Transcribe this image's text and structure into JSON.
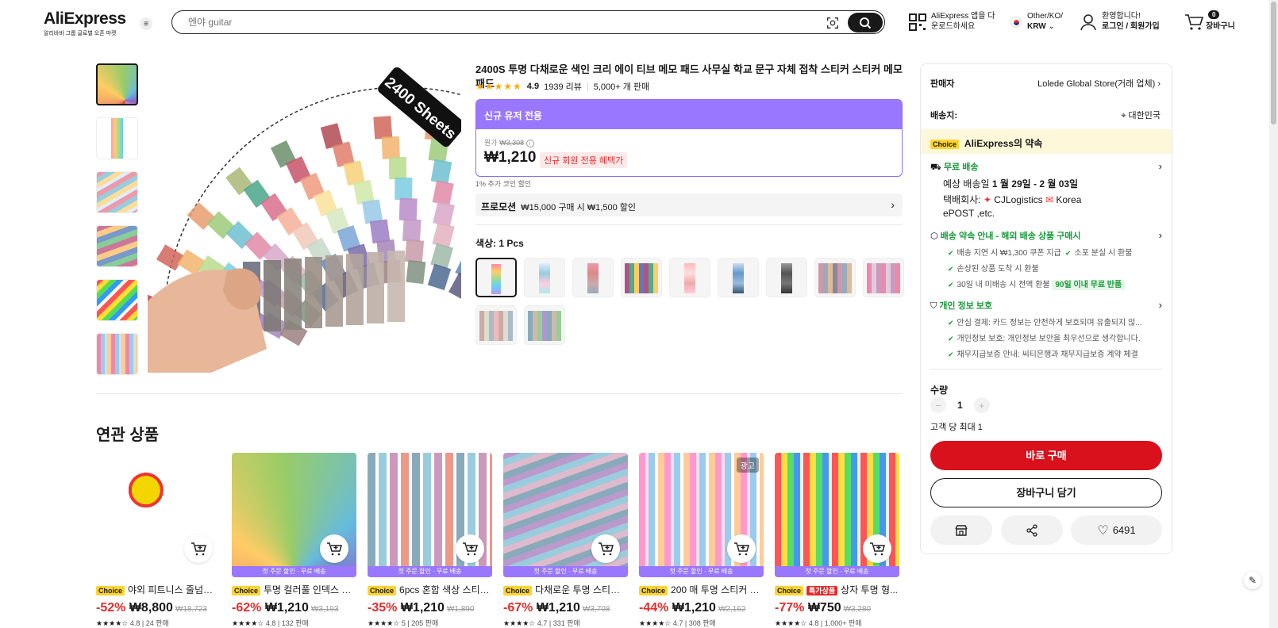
{
  "header": {
    "logo": "AliExpress",
    "logo_sub": "알리바바 그룹 글로벌 오픈 마켓",
    "search_placeholder": "엔야 guitar",
    "app_line1": "AliExpress 앱을 다",
    "app_line2": "운로드하세요",
    "region_line1": "Other/KO/",
    "region_line2": "KRW",
    "account_line1": "환영합니다!",
    "account_line2": "로그인 / 회원가입",
    "cart_count": "0",
    "cart_label": "장바구니"
  },
  "product": {
    "title": "2400S 투명 다채로운 색인 크리 에이 티브 메모 패드 사무실 학교 문구 자체 접착 스티커 스티커 메모 패드",
    "rating": "4.9",
    "reviews": "1939 리뷰",
    "sold": "5,000+ 개 판매",
    "image_banner": "2400 Sheets",
    "price_header": "신규 유저 전용",
    "orig_label": "원가",
    "orig_price": "₩3,308",
    "price": "₩1,210",
    "price_tag": "신규 회원 전용 혜택가",
    "coin_note": "1% 추가 코인 할인",
    "promo_title": "프로모션",
    "promo_text": "₩15,000 구매 시 ₩1,500 할인",
    "color_label": "색상: 1 Pcs"
  },
  "related": {
    "title": "연관 상품",
    "bar_text": "첫 주문 할인 · 무료 배송",
    "ad_label": "광고",
    "choice_label": "Choice",
    "items": [
      {
        "name": "야외 피트니스 줄넘기 ...",
        "disc": "-52%",
        "price": "₩8,800",
        "old": "₩18,723",
        "rating": "4.8",
        "sold": "24 판매",
        "badge": ""
      },
      {
        "name": "투명 컬러풀 인덱스 크...",
        "disc": "-62%",
        "price": "₩1,210",
        "old": "₩3,193",
        "rating": "4.8",
        "sold": "132 판매",
        "badge": ""
      },
      {
        "name": "6pcs 혼합 색상 스티커...",
        "disc": "-35%",
        "price": "₩1,210",
        "old": "₩1,890",
        "rating": "5",
        "sold": "205 판매",
        "badge": ""
      },
      {
        "name": "다채로운 투명 스티커 ...",
        "disc": "-67%",
        "price": "₩1,210",
        "old": "₩3,708",
        "rating": "4.7",
        "sold": "331 판매",
        "badge": ""
      },
      {
        "name": "200 매 투명 스티커 메...",
        "disc": "-44%",
        "price": "₩1,210",
        "old": "₩2,162",
        "rating": "4.7",
        "sold": "308 판매",
        "badge": ""
      },
      {
        "name": "상자 투명 형...",
        "disc": "-77%",
        "price": "₩750",
        "old": "₩3,280",
        "rating": "4.8",
        "sold": "1,000+ 판매",
        "badge": "특가상품"
      }
    ]
  },
  "panel": {
    "seller_label": "판매자",
    "seller": "Lolede Global Store(거래 업체)",
    "ship_label": "배송지:",
    "ship_to": "대한민국",
    "choice": "Choice",
    "choice_text": "AliExpress의 약속",
    "free_ship": "무료 배송",
    "eta_prefix": "예상 배송일",
    "eta": "1 월 29일 - 2 월 03일",
    "courier_label": "택배회사:",
    "courier1": "CJLogistics",
    "courier2": "Korea",
    "courier3": "ePOST ,etc.",
    "promise": "배송 약속 안내 - 해외 배송 상품 구매시",
    "p1": "배송 지연 시 ₩1,300 쿠폰 지급",
    "p2": "소포 분실 시 환불",
    "p3": "손상된 상품 도착 시 환불",
    "p4": "30일 내 미배송 시 전액 환불",
    "p4_tag": "90일 이내 무료 반품",
    "privacy": "개인 정보 보호",
    "s1": "안심 결제: 카드 정보는 안전하게 보호되며 유출되지 않...",
    "s2": "개인정보 보호: 개인정보 보안을 최우선으로 생각합니다.",
    "s3": "채무지급보증 안내: 씨티은행과 채무지급보증 계약 체결",
    "qty_label": "수량",
    "qty": "1",
    "limit": "고객 당 최대 1",
    "buy": "바로 구매",
    "add_cart": "장바구니 담기",
    "wish_count": "6491"
  },
  "colors": {
    "accent_red": "#d8111d",
    "purple": "#9978ff",
    "choice_yellow": "#fcd430"
  }
}
